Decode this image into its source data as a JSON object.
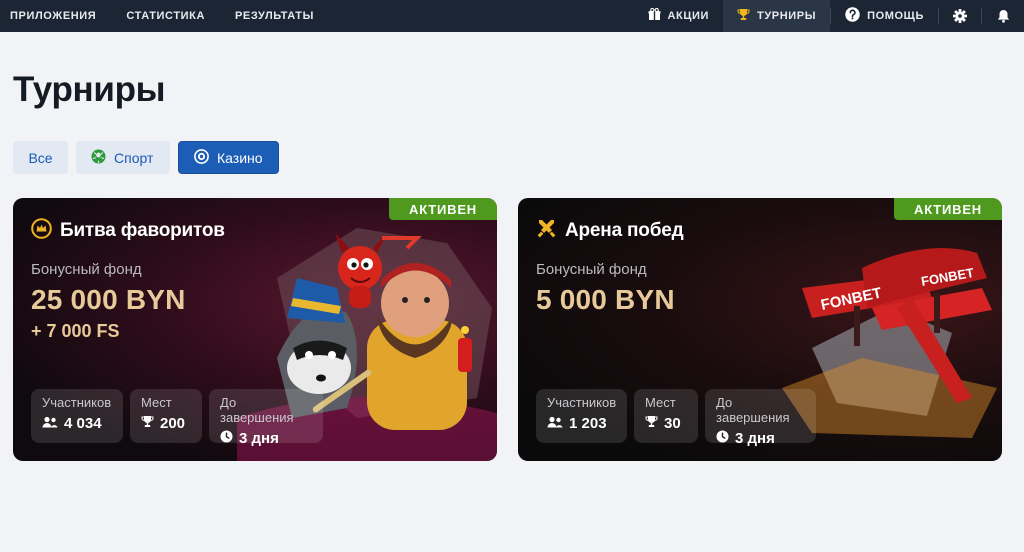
{
  "nav": {
    "left": [
      "ПРИЛОЖЕНИЯ",
      "СТАТИСТИКА",
      "РЕЗУЛЬТАТЫ"
    ],
    "promotions": "АКЦИИ",
    "tournaments": "ТУРНИРЫ",
    "help": "ПОМОЩЬ"
  },
  "page": {
    "title": "Турниры"
  },
  "filters": {
    "all": "Все",
    "sport": "Спорт",
    "casino": "Казино",
    "selected": "Казино"
  },
  "cards": [
    {
      "badge": "АКТИВЕН",
      "title": "Битва фаворитов",
      "fund_label": "Бонусный фонд",
      "fund_value": "25 000 BYN",
      "fund_extra": "+ 7 000 FS",
      "stats": [
        {
          "label": "Участников",
          "value": "4 034"
        },
        {
          "label": "Мест",
          "value": "200"
        },
        {
          "label": "До завершения",
          "value": "3 дня"
        }
      ]
    },
    {
      "badge": "АКТИВЕН",
      "title": "Арена побед",
      "fund_label": "Бонусный фонд",
      "fund_value": "5 000 BYN",
      "art_text": [
        "FONBET",
        "FONBET"
      ],
      "stats": [
        {
          "label": "Участников",
          "value": "1 203"
        },
        {
          "label": "Мест",
          "value": "30"
        },
        {
          "label": "До завершения",
          "value": "3 дня"
        }
      ]
    }
  ],
  "colors": {
    "nav_bg": "#1b2533",
    "accent_blue": "#1c5db6",
    "active_green": "#4f9a1e",
    "fund_gold": "#e8c999"
  }
}
